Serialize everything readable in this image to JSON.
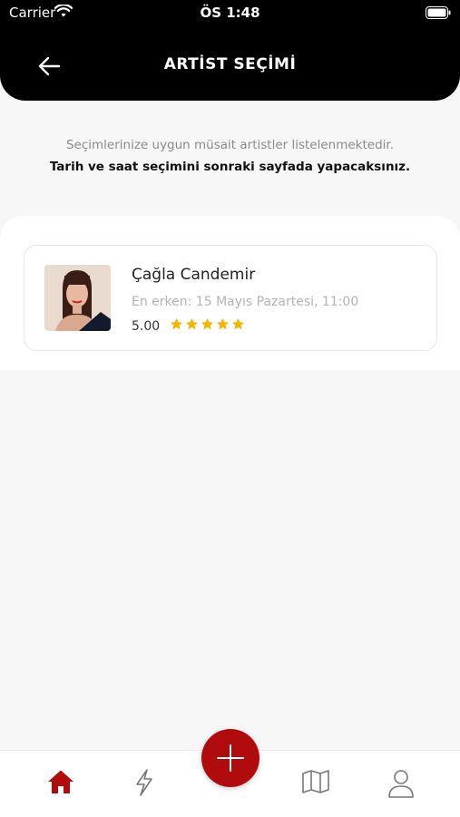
{
  "status_bar": {
    "carrier": "Carrier",
    "time": "ÖS 1:48"
  },
  "header": {
    "title": "ARTİST SEÇİMİ"
  },
  "info": {
    "line1": "Seçimlerinize uygun müsait artistler listelenmektedir.",
    "line2": "Tarih ve saat seçimini sonraki sayfada yapacaksınız."
  },
  "artists": [
    {
      "name": "Çağla Candemir",
      "earliest": "En erken: 15 Mayıs Pazartesi, 11:00",
      "rating": "5.00",
      "stars": 5
    }
  ],
  "tabbar": {
    "items": [
      "home-icon",
      "lightning-icon",
      "add-icon",
      "map-icon",
      "user-icon"
    ],
    "active": "home-icon"
  },
  "colors": {
    "accent": "#b00c0e",
    "header_bg": "#000000",
    "star": "#f5b400",
    "page_bg": "#f7f7f7"
  }
}
